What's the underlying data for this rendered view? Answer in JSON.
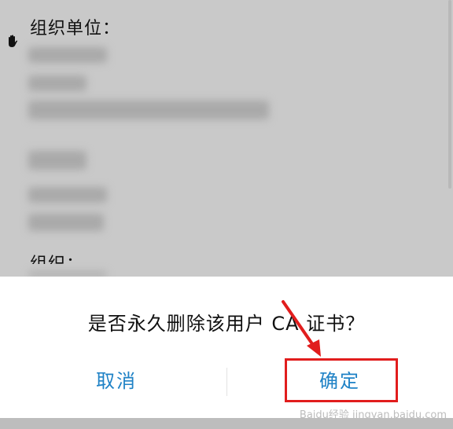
{
  "background": {
    "org_label": "组织单位：",
    "cut_label": "组织："
  },
  "dialog": {
    "message": "是否永久删除该用户 CA 证书？",
    "cancel_label": "取消",
    "confirm_label": "确定"
  },
  "watermark": "Baidu经验 jingyan.baidu.com",
  "colors": {
    "accent": "#1f82c6",
    "annotation_red": "#e11d1d",
    "overlay_gray": "#c9c9c9"
  }
}
